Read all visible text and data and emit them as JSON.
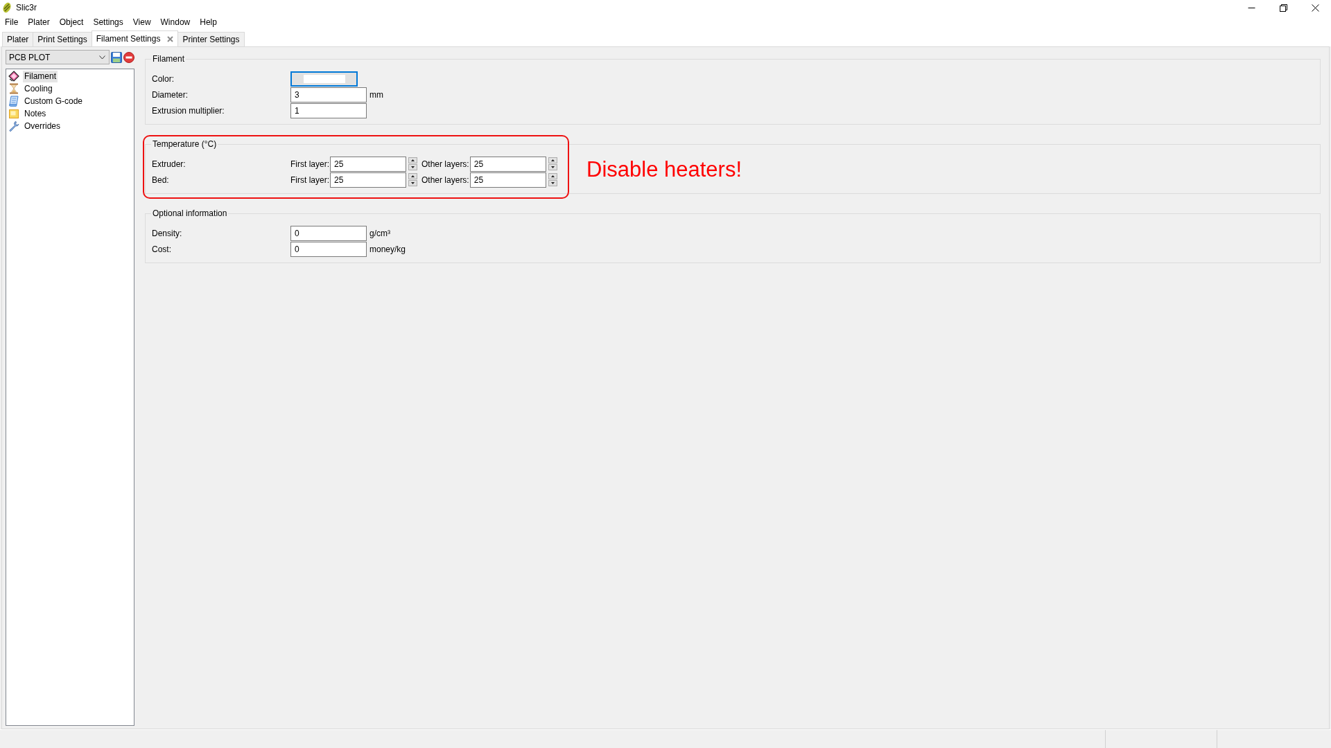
{
  "window": {
    "title": "Slic3r"
  },
  "menu_bar": [
    "File",
    "Plater",
    "Object",
    "Settings",
    "View",
    "Window",
    "Help"
  ],
  "tabs": [
    {
      "label": "Plater",
      "selected": false,
      "closable": false
    },
    {
      "label": "Print Settings",
      "selected": false,
      "closable": false
    },
    {
      "label": "Filament Settings",
      "selected": true,
      "closable": true
    },
    {
      "label": "Printer Settings",
      "selected": false,
      "closable": false
    }
  ],
  "preset": {
    "value": "PCB PLOT"
  },
  "sidebar": {
    "items": [
      {
        "label": "Filament",
        "selected": true
      },
      {
        "label": "Cooling",
        "selected": false
      },
      {
        "label": "Custom G-code",
        "selected": false
      },
      {
        "label": "Notes",
        "selected": false
      },
      {
        "label": "Overrides",
        "selected": false
      }
    ]
  },
  "groups": [
    {
      "title": "Filament",
      "rows": [
        {
          "kind": "color",
          "label": "Color:",
          "color": "#ffffff",
          "focused": true
        },
        {
          "kind": "text",
          "label": "Diameter:",
          "value": "3",
          "unit": "mm"
        },
        {
          "kind": "text",
          "label": "Extrusion multiplier:",
          "value": "1"
        }
      ]
    },
    {
      "title": "Temperature (°C)",
      "annotation": {
        "text": "Disable heaters!"
      },
      "rows": [
        {
          "kind": "pair",
          "label": "Extruder:",
          "fields": [
            {
              "label": "First layer:",
              "value": "25"
            },
            {
              "label": "Other layers:",
              "value": "25"
            }
          ]
        },
        {
          "kind": "pair",
          "label": "Bed:",
          "fields": [
            {
              "label": "First layer:",
              "value": "25"
            },
            {
              "label": "Other layers:",
              "value": "25"
            }
          ]
        }
      ]
    },
    {
      "title": "Optional information",
      "rows": [
        {
          "kind": "text",
          "label": "Density:",
          "value": "0",
          "unit": "g/cm³"
        },
        {
          "kind": "text",
          "label": "Cost:",
          "value": "0",
          "unit": "money/kg"
        }
      ]
    }
  ]
}
